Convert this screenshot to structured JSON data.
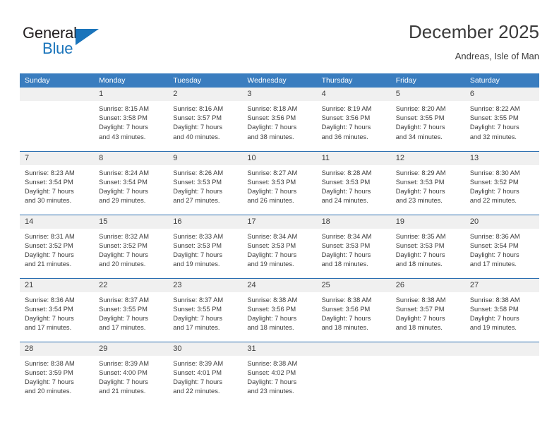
{
  "logo": {
    "general_text": "General",
    "blue_text": "Blue",
    "triangle_color": "#1a74bb"
  },
  "header": {
    "title": "December 2025",
    "subtitle": "Andreas, Isle of Man"
  },
  "theme": {
    "header_bg": "#3a7dbf",
    "row_border": "#2a6eb0",
    "daynum_bg": "#f0f0f0",
    "text": "#3b3b3b"
  },
  "weekdays": [
    "Sunday",
    "Monday",
    "Tuesday",
    "Wednesday",
    "Thursday",
    "Friday",
    "Saturday"
  ],
  "weeks": [
    [
      {
        "day": "",
        "blank": true,
        "sunrise": "",
        "sunset": "",
        "daylight1": "",
        "daylight2": ""
      },
      {
        "day": "1",
        "blank": false,
        "sunrise": "Sunrise: 8:15 AM",
        "sunset": "Sunset: 3:58 PM",
        "daylight1": "Daylight: 7 hours",
        "daylight2": "and 43 minutes."
      },
      {
        "day": "2",
        "blank": false,
        "sunrise": "Sunrise: 8:16 AM",
        "sunset": "Sunset: 3:57 PM",
        "daylight1": "Daylight: 7 hours",
        "daylight2": "and 40 minutes."
      },
      {
        "day": "3",
        "blank": false,
        "sunrise": "Sunrise: 8:18 AM",
        "sunset": "Sunset: 3:56 PM",
        "daylight1": "Daylight: 7 hours",
        "daylight2": "and 38 minutes."
      },
      {
        "day": "4",
        "blank": false,
        "sunrise": "Sunrise: 8:19 AM",
        "sunset": "Sunset: 3:56 PM",
        "daylight1": "Daylight: 7 hours",
        "daylight2": "and 36 minutes."
      },
      {
        "day": "5",
        "blank": false,
        "sunrise": "Sunrise: 8:20 AM",
        "sunset": "Sunset: 3:55 PM",
        "daylight1": "Daylight: 7 hours",
        "daylight2": "and 34 minutes."
      },
      {
        "day": "6",
        "blank": false,
        "sunrise": "Sunrise: 8:22 AM",
        "sunset": "Sunset: 3:55 PM",
        "daylight1": "Daylight: 7 hours",
        "daylight2": "and 32 minutes."
      }
    ],
    [
      {
        "day": "7",
        "blank": false,
        "sunrise": "Sunrise: 8:23 AM",
        "sunset": "Sunset: 3:54 PM",
        "daylight1": "Daylight: 7 hours",
        "daylight2": "and 30 minutes."
      },
      {
        "day": "8",
        "blank": false,
        "sunrise": "Sunrise: 8:24 AM",
        "sunset": "Sunset: 3:54 PM",
        "daylight1": "Daylight: 7 hours",
        "daylight2": "and 29 minutes."
      },
      {
        "day": "9",
        "blank": false,
        "sunrise": "Sunrise: 8:26 AM",
        "sunset": "Sunset: 3:53 PM",
        "daylight1": "Daylight: 7 hours",
        "daylight2": "and 27 minutes."
      },
      {
        "day": "10",
        "blank": false,
        "sunrise": "Sunrise: 8:27 AM",
        "sunset": "Sunset: 3:53 PM",
        "daylight1": "Daylight: 7 hours",
        "daylight2": "and 26 minutes."
      },
      {
        "day": "11",
        "blank": false,
        "sunrise": "Sunrise: 8:28 AM",
        "sunset": "Sunset: 3:53 PM",
        "daylight1": "Daylight: 7 hours",
        "daylight2": "and 24 minutes."
      },
      {
        "day": "12",
        "blank": false,
        "sunrise": "Sunrise: 8:29 AM",
        "sunset": "Sunset: 3:53 PM",
        "daylight1": "Daylight: 7 hours",
        "daylight2": "and 23 minutes."
      },
      {
        "day": "13",
        "blank": false,
        "sunrise": "Sunrise: 8:30 AM",
        "sunset": "Sunset: 3:52 PM",
        "daylight1": "Daylight: 7 hours",
        "daylight2": "and 22 minutes."
      }
    ],
    [
      {
        "day": "14",
        "blank": false,
        "sunrise": "Sunrise: 8:31 AM",
        "sunset": "Sunset: 3:52 PM",
        "daylight1": "Daylight: 7 hours",
        "daylight2": "and 21 minutes."
      },
      {
        "day": "15",
        "blank": false,
        "sunrise": "Sunrise: 8:32 AM",
        "sunset": "Sunset: 3:52 PM",
        "daylight1": "Daylight: 7 hours",
        "daylight2": "and 20 minutes."
      },
      {
        "day": "16",
        "blank": false,
        "sunrise": "Sunrise: 8:33 AM",
        "sunset": "Sunset: 3:53 PM",
        "daylight1": "Daylight: 7 hours",
        "daylight2": "and 19 minutes."
      },
      {
        "day": "17",
        "blank": false,
        "sunrise": "Sunrise: 8:34 AM",
        "sunset": "Sunset: 3:53 PM",
        "daylight1": "Daylight: 7 hours",
        "daylight2": "and 19 minutes."
      },
      {
        "day": "18",
        "blank": false,
        "sunrise": "Sunrise: 8:34 AM",
        "sunset": "Sunset: 3:53 PM",
        "daylight1": "Daylight: 7 hours",
        "daylight2": "and 18 minutes."
      },
      {
        "day": "19",
        "blank": false,
        "sunrise": "Sunrise: 8:35 AM",
        "sunset": "Sunset: 3:53 PM",
        "daylight1": "Daylight: 7 hours",
        "daylight2": "and 18 minutes."
      },
      {
        "day": "20",
        "blank": false,
        "sunrise": "Sunrise: 8:36 AM",
        "sunset": "Sunset: 3:54 PM",
        "daylight1": "Daylight: 7 hours",
        "daylight2": "and 17 minutes."
      }
    ],
    [
      {
        "day": "21",
        "blank": false,
        "sunrise": "Sunrise: 8:36 AM",
        "sunset": "Sunset: 3:54 PM",
        "daylight1": "Daylight: 7 hours",
        "daylight2": "and 17 minutes."
      },
      {
        "day": "22",
        "blank": false,
        "sunrise": "Sunrise: 8:37 AM",
        "sunset": "Sunset: 3:55 PM",
        "daylight1": "Daylight: 7 hours",
        "daylight2": "and 17 minutes."
      },
      {
        "day": "23",
        "blank": false,
        "sunrise": "Sunrise: 8:37 AM",
        "sunset": "Sunset: 3:55 PM",
        "daylight1": "Daylight: 7 hours",
        "daylight2": "and 17 minutes."
      },
      {
        "day": "24",
        "blank": false,
        "sunrise": "Sunrise: 8:38 AM",
        "sunset": "Sunset: 3:56 PM",
        "daylight1": "Daylight: 7 hours",
        "daylight2": "and 18 minutes."
      },
      {
        "day": "25",
        "blank": false,
        "sunrise": "Sunrise: 8:38 AM",
        "sunset": "Sunset: 3:56 PM",
        "daylight1": "Daylight: 7 hours",
        "daylight2": "and 18 minutes."
      },
      {
        "day": "26",
        "blank": false,
        "sunrise": "Sunrise: 8:38 AM",
        "sunset": "Sunset: 3:57 PM",
        "daylight1": "Daylight: 7 hours",
        "daylight2": "and 18 minutes."
      },
      {
        "day": "27",
        "blank": false,
        "sunrise": "Sunrise: 8:38 AM",
        "sunset": "Sunset: 3:58 PM",
        "daylight1": "Daylight: 7 hours",
        "daylight2": "and 19 minutes."
      }
    ],
    [
      {
        "day": "28",
        "blank": false,
        "sunrise": "Sunrise: 8:38 AM",
        "sunset": "Sunset: 3:59 PM",
        "daylight1": "Daylight: 7 hours",
        "daylight2": "and 20 minutes."
      },
      {
        "day": "29",
        "blank": false,
        "sunrise": "Sunrise: 8:39 AM",
        "sunset": "Sunset: 4:00 PM",
        "daylight1": "Daylight: 7 hours",
        "daylight2": "and 21 minutes."
      },
      {
        "day": "30",
        "blank": false,
        "sunrise": "Sunrise: 8:39 AM",
        "sunset": "Sunset: 4:01 PM",
        "daylight1": "Daylight: 7 hours",
        "daylight2": "and 22 minutes."
      },
      {
        "day": "31",
        "blank": false,
        "sunrise": "Sunrise: 8:38 AM",
        "sunset": "Sunset: 4:02 PM",
        "daylight1": "Daylight: 7 hours",
        "daylight2": "and 23 minutes."
      },
      {
        "day": "",
        "blank": true,
        "sunrise": "",
        "sunset": "",
        "daylight1": "",
        "daylight2": ""
      },
      {
        "day": "",
        "blank": true,
        "sunrise": "",
        "sunset": "",
        "daylight1": "",
        "daylight2": ""
      },
      {
        "day": "",
        "blank": true,
        "sunrise": "",
        "sunset": "",
        "daylight1": "",
        "daylight2": ""
      }
    ]
  ]
}
